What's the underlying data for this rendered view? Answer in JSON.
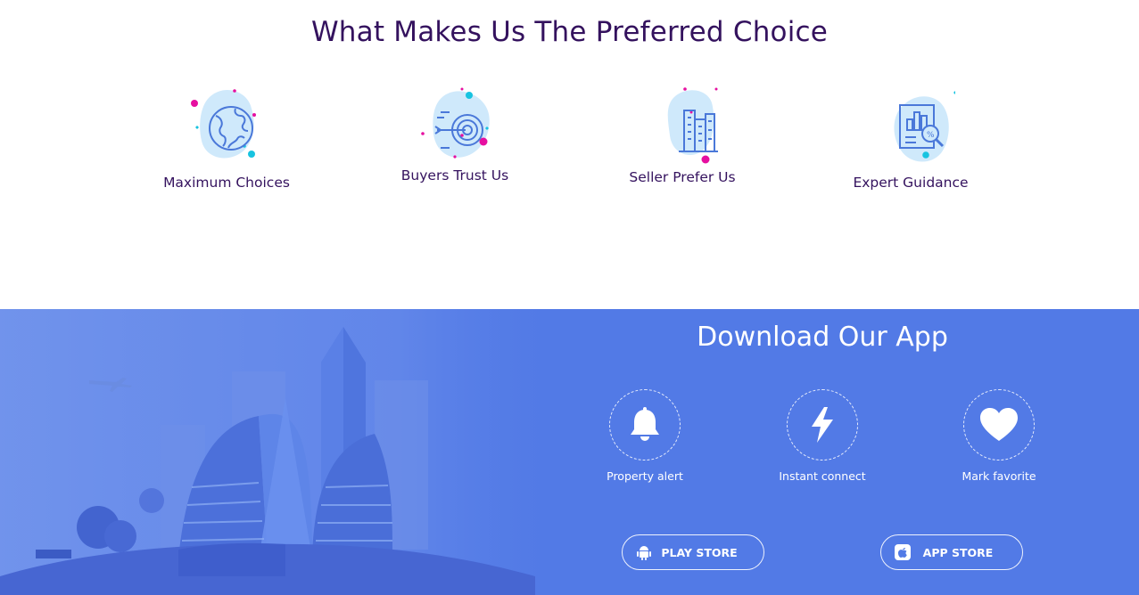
{
  "top": {
    "title": "What Makes Us The Preferred Choice",
    "features": [
      {
        "label": "Maximum Choices",
        "icon": "globe-icon"
      },
      {
        "label": "Buyers Trust Us",
        "icon": "target-icon"
      },
      {
        "label": "Seller Prefer Us",
        "icon": "buildings-icon"
      },
      {
        "label": "Expert Guidance",
        "icon": "report-analysis-icon"
      }
    ]
  },
  "app": {
    "title": "Download Our App",
    "features": [
      {
        "label": "Property alert",
        "icon": "bell-icon"
      },
      {
        "label": "Instant connect",
        "icon": "lightning-icon"
      },
      {
        "label": "Mark favorite",
        "icon": "heart-icon"
      }
    ],
    "play_store": {
      "label": "PLAY STORE",
      "icon": "android-icon"
    },
    "app_store": {
      "label": "APP STORE",
      "icon": "apple-icon"
    }
  },
  "colors": {
    "heading": "#34125e",
    "banner_bg": "#527ae6",
    "accent_pink": "#e60fa0",
    "accent_cyan": "#17c3e0",
    "icon_blob": "#cfe9fb",
    "icon_stroke": "#4a78d9"
  }
}
